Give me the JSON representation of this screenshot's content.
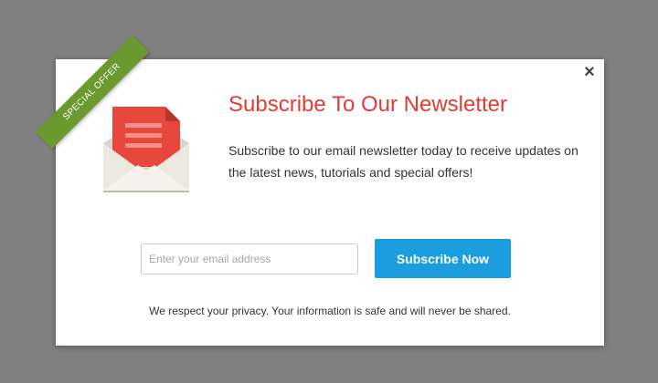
{
  "popup": {
    "ribbon_text": "SPECIAL OFFER",
    "title": "Subscribe To Our Newsletter",
    "description": "Subscribe to our email newsletter today to receive updates on the latest news, tutorials and special offers!",
    "close_symbol": "×",
    "email_placeholder": "Enter your email address",
    "subscribe_label": "Subscribe Now",
    "privacy_text": "We respect your privacy. Your information is safe and will never be shared."
  },
  "icons": {
    "close": "close-icon",
    "envelope": "envelope-icon"
  },
  "colors": {
    "overlay": "#808080",
    "title": "#e23c32",
    "button": "#1a9ee0",
    "ribbon": "#6a9a2f"
  }
}
